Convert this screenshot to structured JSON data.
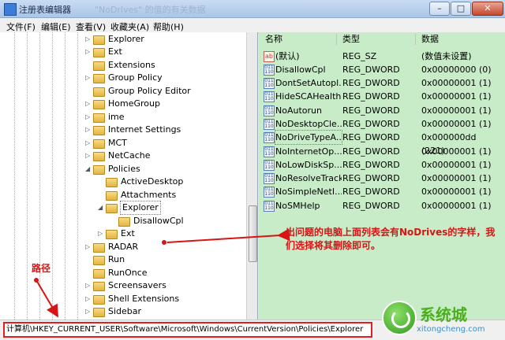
{
  "window": {
    "title": "注册表编辑器",
    "title_faint": "\"NoDrives\" 的值的有关数据",
    "minimize": "–",
    "maximize": "□",
    "close": "✕"
  },
  "menu": [
    "文件(F)",
    "编辑(E)",
    "查看(V)",
    "收藏夹(A)",
    "帮助(H)"
  ],
  "tree": {
    "items": [
      {
        "label": "Explorer",
        "expander": "▷"
      },
      {
        "label": "Ext",
        "expander": "▷"
      },
      {
        "label": "Extensions",
        "expander": ""
      },
      {
        "label": "Group Policy",
        "expander": "▷"
      },
      {
        "label": "Group Policy Editor",
        "expander": ""
      },
      {
        "label": "HomeGroup",
        "expander": "▷"
      },
      {
        "label": "ime",
        "expander": "▷"
      },
      {
        "label": "Internet Settings",
        "expander": "▷"
      },
      {
        "label": "MCT",
        "expander": "▷"
      },
      {
        "label": "NetCache",
        "expander": "▷"
      },
      {
        "label": "Policies",
        "expander": "◢"
      },
      {
        "label": "ActiveDesktop",
        "expander": ""
      },
      {
        "label": "Attachments",
        "expander": ""
      },
      {
        "label": "Explorer",
        "expander": "◢"
      },
      {
        "label": "DisallowCpl",
        "expander": ""
      },
      {
        "label": "Ext",
        "expander": "▷"
      },
      {
        "label": "RADAR",
        "expander": "▷"
      },
      {
        "label": "Run",
        "expander": ""
      },
      {
        "label": "RunOnce",
        "expander": ""
      },
      {
        "label": "Screensavers",
        "expander": "▷"
      },
      {
        "label": "Shell Extensions",
        "expander": "▷"
      },
      {
        "label": "Sidebar",
        "expander": "▷"
      }
    ]
  },
  "list": {
    "headers": {
      "name": "名称",
      "type": "类型",
      "data": "数据"
    },
    "rows": [
      {
        "name": "(默认)",
        "type": "REG_SZ",
        "data": "(数值未设置)",
        "icon": "ab"
      },
      {
        "name": "DisallowCpl",
        "type": "REG_DWORD",
        "data": "0x00000000 (0)",
        "icon": "011\n110"
      },
      {
        "name": "DontSetAutopl...",
        "type": "REG_DWORD",
        "data": "0x00000001 (1)",
        "icon": "011\n110"
      },
      {
        "name": "HideSCAHealth",
        "type": "REG_DWORD",
        "data": "0x00000001 (1)",
        "icon": "011\n110"
      },
      {
        "name": "NoAutorun",
        "type": "REG_DWORD",
        "data": "0x00000001 (1)",
        "icon": "011\n110"
      },
      {
        "name": "NoDesktopCle...",
        "type": "REG_DWORD",
        "data": "0x00000001 (1)",
        "icon": "011\n110"
      },
      {
        "name": "NoDriveTypeA...",
        "type": "REG_DWORD",
        "data": "0x000000dd (221)",
        "icon": "011\n110"
      },
      {
        "name": "NoInternetOp...",
        "type": "REG_DWORD",
        "data": "0x00000001 (1)",
        "icon": "011\n110"
      },
      {
        "name": "NoLowDiskSp...",
        "type": "REG_DWORD",
        "data": "0x00000001 (1)",
        "icon": "011\n110"
      },
      {
        "name": "NoResolveTrack",
        "type": "REG_DWORD",
        "data": "0x00000001 (1)",
        "icon": "011\n110"
      },
      {
        "name": "NoSimpleNetI...",
        "type": "REG_DWORD",
        "data": "0x00000001 (1)",
        "icon": "011\n110"
      },
      {
        "name": "NoSMHelp",
        "type": "REG_DWORD",
        "data": "0x00000001 (1)",
        "icon": "011\n110"
      }
    ]
  },
  "annotation": {
    "note": "出问题的电脑上面列表会有NoDrives的字样，我们选择将其删除即可。",
    "path_label": "路径",
    "accent_color": "#d61515"
  },
  "statusbar": {
    "path": "计算机\\HKEY_CURRENT_USER\\Software\\Microsoft\\Windows\\CurrentVersion\\Policies\\Explorer"
  },
  "watermark": {
    "brand": "系统城",
    "site": "xitongcheng.com"
  }
}
